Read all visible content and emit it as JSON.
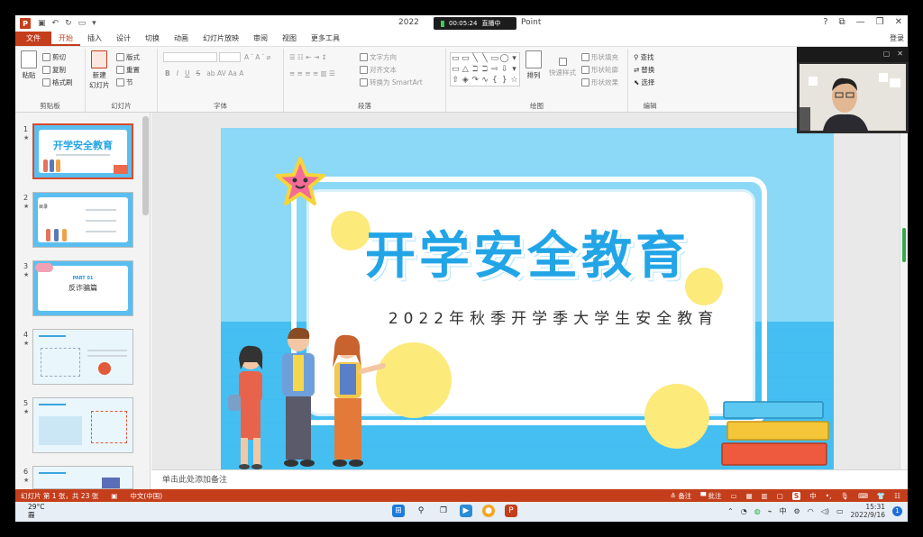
{
  "window": {
    "title_left": "2022",
    "title_right": "Point",
    "live_time": "00:05:24",
    "live_label": "直播中",
    "controls": [
      "?",
      "⧉",
      "—",
      "❐",
      "✕"
    ]
  },
  "tabs": [
    "文件",
    "开始",
    "插入",
    "设计",
    "切换",
    "动画",
    "幻灯片放映",
    "审阅",
    "视图",
    "更多工具"
  ],
  "active_tab": "开始",
  "login": "登录",
  "ribbon": {
    "clipboard": {
      "label": "剪贴板",
      "paste": "粘贴",
      "cut": "剪切",
      "copy": "复制",
      "format_painter": "格式刷"
    },
    "slides": {
      "label": "幻灯片",
      "new_slide": "新建\n幻灯片",
      "layout": "版式",
      "reset": "重置",
      "section": "节"
    },
    "font": {
      "label": "字体"
    },
    "paragraph": {
      "label": "段落",
      "text_direction": "文字方向",
      "align_text": "对齐文本",
      "smartart": "转换为 SmartArt"
    },
    "drawing": {
      "label": "绘图",
      "arrange": "排列",
      "quick_styles": "快速样式",
      "shape_fill": "形状填充",
      "shape_outline": "形状轮廓",
      "shape_effects": "形状效果"
    },
    "editing": {
      "label": "编辑",
      "find": "查找",
      "replace": "替换",
      "select": "选择"
    }
  },
  "thumbnails": [
    {
      "num": "1",
      "title": "开学安全教育",
      "sub": ""
    },
    {
      "num": "2",
      "title": "",
      "sub": "目录"
    },
    {
      "num": "3",
      "title": "",
      "part": "PART 01",
      "sub": "反诈骗篇"
    },
    {
      "num": "4",
      "title": "",
      "sub": ""
    },
    {
      "num": "5",
      "title": "",
      "sub": ""
    },
    {
      "num": "6",
      "title": "",
      "sub": ""
    }
  ],
  "slide": {
    "title": "开学安全教育",
    "subtitle": "2022年秋季开学季大学生安全教育"
  },
  "notes_placeholder": "单击此处添加备注",
  "status": {
    "slide_info": "幻灯片 第 1 张，共 23 张",
    "language": "中文(中国)",
    "notes": "备注",
    "comments": "批注",
    "ime": "中"
  },
  "taskbar": {
    "temperature": "29°C",
    "weather": "霾",
    "time": "15:31",
    "date": "2022/9/16",
    "notification_count": "1"
  },
  "colors": {
    "accent": "#c43e1c",
    "slide_blue": "#4ec3f3",
    "title_blue": "#22a5e6",
    "yellow": "#fcea7b"
  }
}
